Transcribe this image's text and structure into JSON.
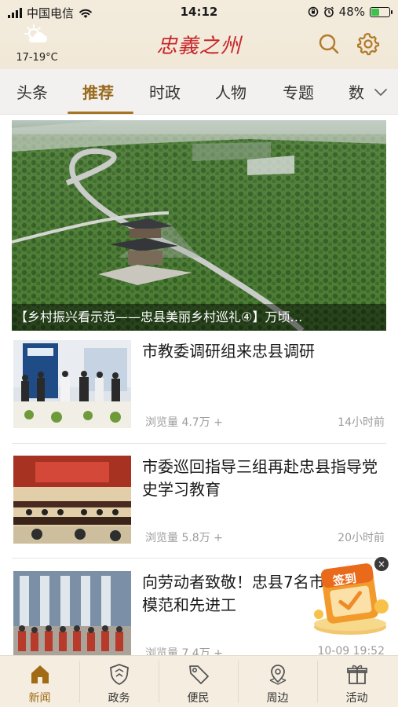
{
  "status_bar": {
    "carrier": "中国电信",
    "time": "14:12",
    "battery_percent": "48%",
    "battery_level": 0.48
  },
  "header": {
    "weather_temp": "17-19°C",
    "logo_text": "忠義之州",
    "search_icon": "search-icon",
    "settings_icon": "gear-icon"
  },
  "tabs": [
    {
      "label": "头条"
    },
    {
      "label": "推荐"
    },
    {
      "label": "时政"
    },
    {
      "label": "人物"
    },
    {
      "label": "专题"
    },
    {
      "label": "数"
    }
  ],
  "active_tab": "推荐",
  "hero": {
    "caption": "【乡村振兴看示范——忠县美丽乡村巡礼④】万顷…"
  },
  "news": [
    {
      "title": "市教委调研组来忠县调研",
      "views": "浏览量 4.7万 +",
      "time": "14小时前"
    },
    {
      "title": "市委巡回指导三组再赴忠县指导党史学习教育",
      "views": "浏览量 5.8万 +",
      "time": "20小时前"
    },
    {
      "title": "向劳动者致敬！忠县7名市级劳动模范和先进工",
      "views": "浏览量 7.4万 +",
      "time": "10-09 19:52"
    }
  ],
  "float_signin": {
    "label": "签到",
    "close": "×"
  },
  "bottom_nav": [
    {
      "label": "新闻",
      "icon": "home-icon"
    },
    {
      "label": "政务",
      "icon": "shield-icon"
    },
    {
      "label": "便民",
      "icon": "tag-icon"
    },
    {
      "label": "周边",
      "icon": "map-pin-icon"
    },
    {
      "label": "活动",
      "icon": "gift-icon"
    }
  ],
  "colors": {
    "accent": "#a16a15",
    "header_bg": "#f2e9d8",
    "logo": "#c8262a"
  }
}
